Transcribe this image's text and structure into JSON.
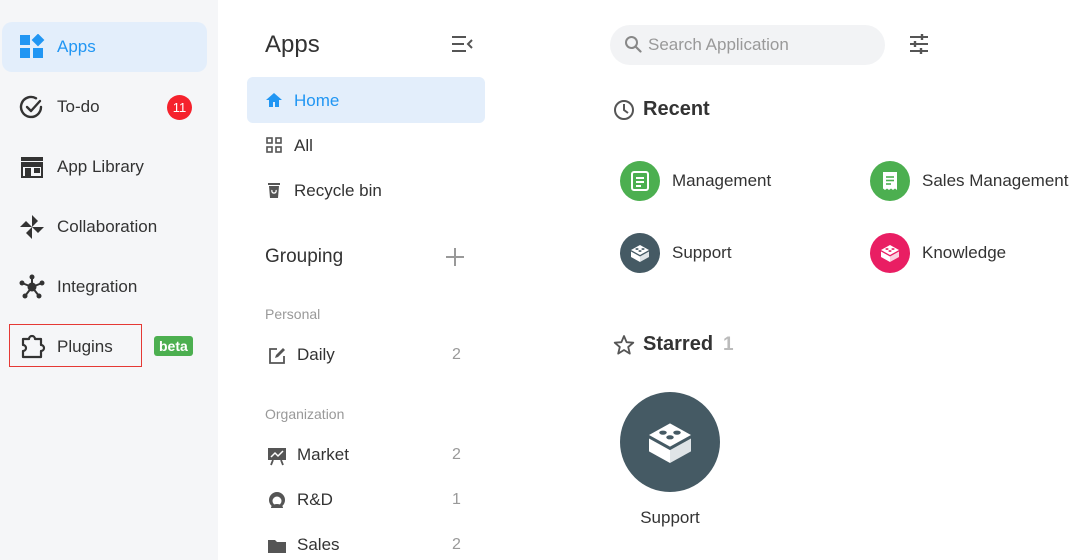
{
  "nav": {
    "items": [
      {
        "label": "Apps",
        "icon": "apps-grid-icon",
        "active": true
      },
      {
        "label": "To-do",
        "icon": "check-circle-icon",
        "badge": "11"
      },
      {
        "label": "App Library",
        "icon": "store-icon"
      },
      {
        "label": "Collaboration",
        "icon": "pinwheel-icon"
      },
      {
        "label": "Integration",
        "icon": "network-hub-icon"
      },
      {
        "label": "Plugins",
        "icon": "puzzle-icon",
        "badge": "beta"
      }
    ]
  },
  "sidebar": {
    "title": "Apps",
    "main_items": [
      {
        "label": "Home",
        "icon": "home-icon",
        "active": true
      },
      {
        "label": "All",
        "icon": "grid-icon"
      },
      {
        "label": "Recycle bin",
        "icon": "trash-icon"
      }
    ],
    "grouping_title": "Grouping",
    "personal_label": "Personal",
    "personal_groups": [
      {
        "label": "Daily",
        "count": "2",
        "icon": "edit-note-icon"
      }
    ],
    "organization_label": "Organization",
    "organization_groups": [
      {
        "label": "Market",
        "count": "2",
        "icon": "presentation-chart-icon"
      },
      {
        "label": "R&D",
        "count": "1",
        "icon": "person-headset-icon"
      },
      {
        "label": "Sales",
        "count": "2",
        "icon": "folder-icon"
      }
    ]
  },
  "search": {
    "placeholder": "Search Application",
    "value": ""
  },
  "recent": {
    "title": "Recent",
    "apps": [
      {
        "label": "Management",
        "color": "#4caf50",
        "icon": "document-icon"
      },
      {
        "label": "Sales Management",
        "color": "#4caf50",
        "icon": "receipt-icon"
      },
      {
        "label": "Support",
        "color": "#455a64",
        "icon": "building-block-icon"
      },
      {
        "label": "Knowledge",
        "color": "#e91e63",
        "icon": "building-block-icon"
      }
    ]
  },
  "starred": {
    "title": "Starred",
    "count": "1",
    "apps": [
      {
        "label": "Support",
        "color": "#455a64",
        "icon": "building-block-icon"
      }
    ]
  },
  "colors": {
    "accent": "#2196f3",
    "active_bg": "#e3eefb",
    "badge_red": "#f5222d",
    "beta_green": "#4caf50",
    "highlight": "#e53935"
  }
}
